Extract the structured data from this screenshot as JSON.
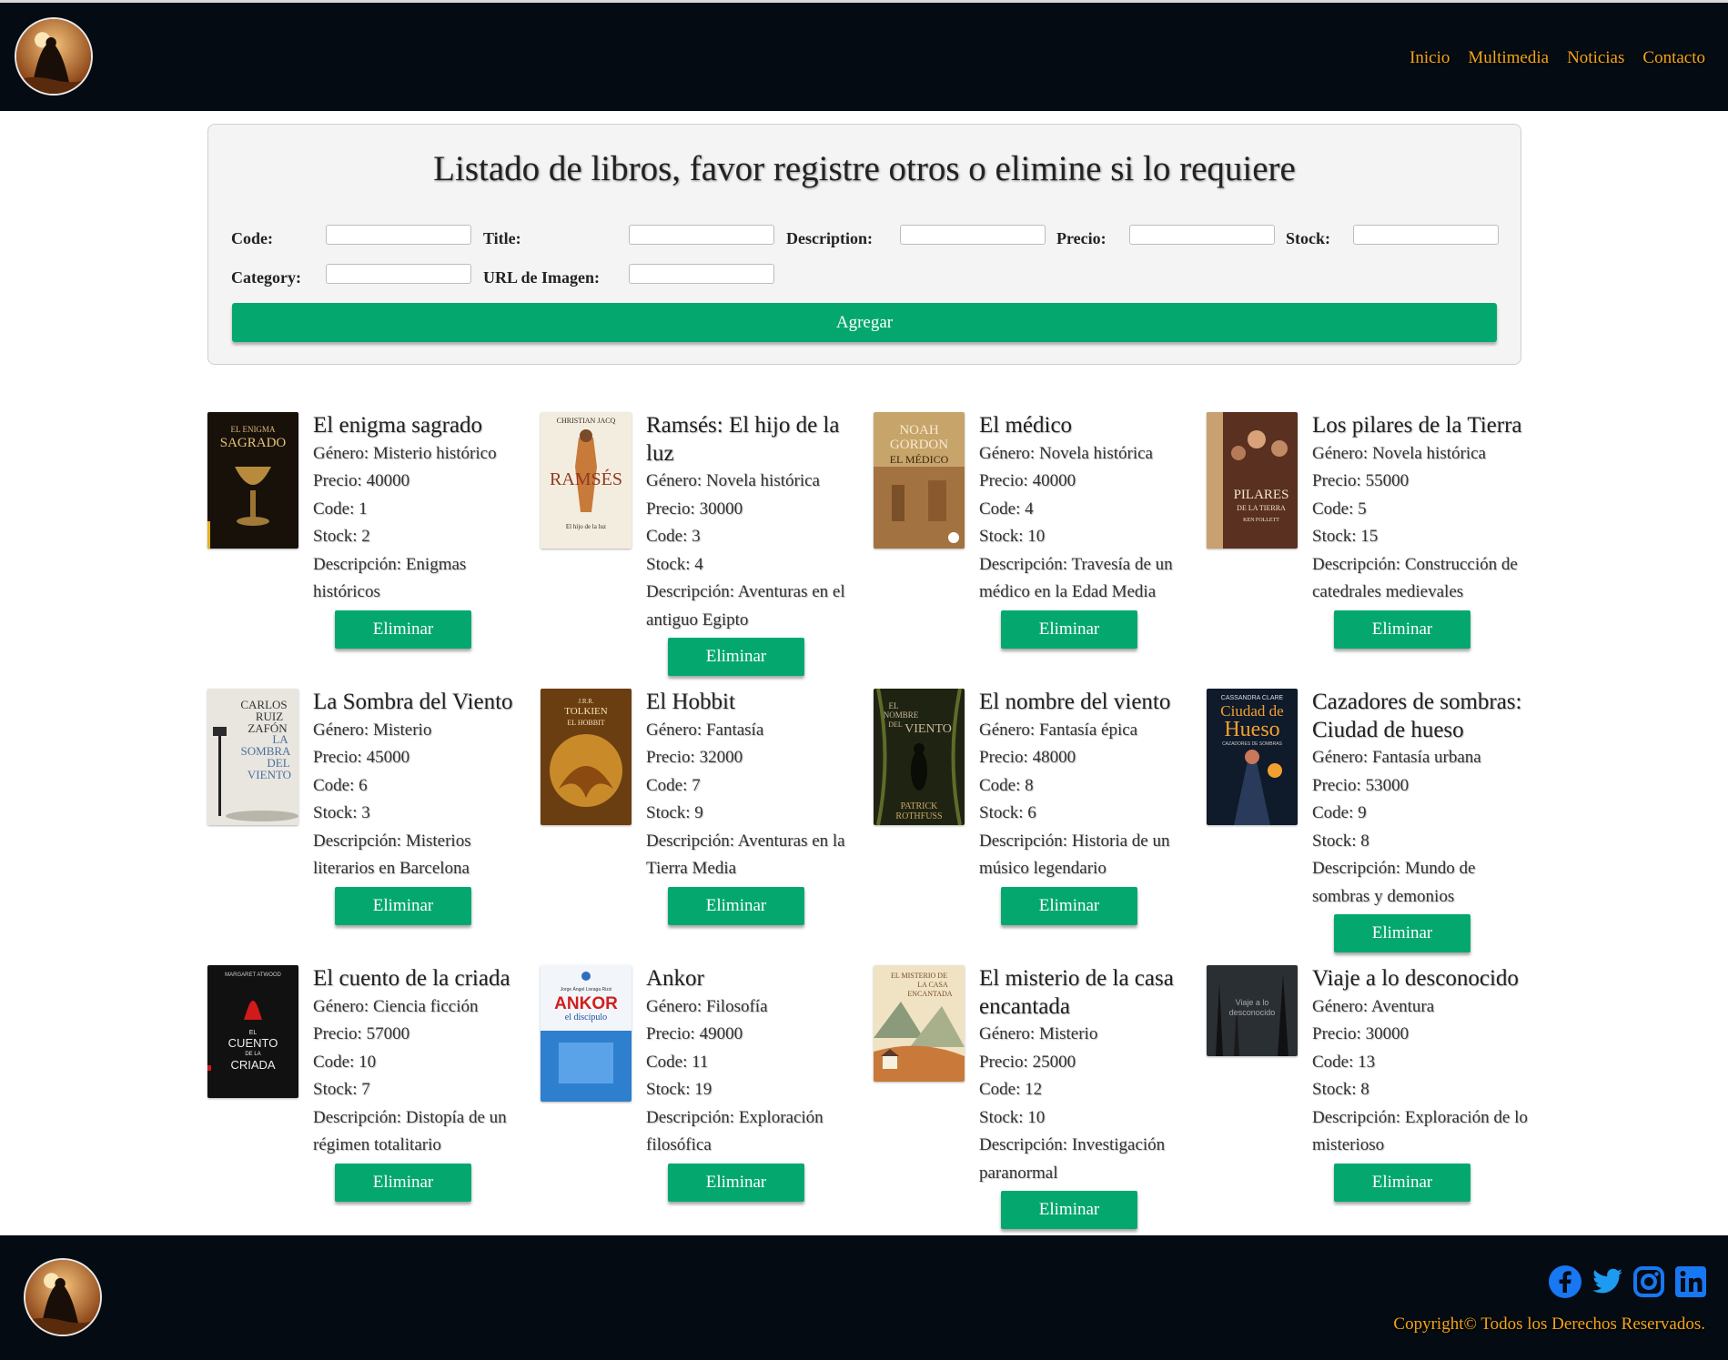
{
  "nav": [
    "Inicio",
    "Multimedia",
    "Noticias",
    "Contacto"
  ],
  "form": {
    "heading": "Listado de libros, favor registre otros o elimine si lo requiere",
    "labels": {
      "code": "Code:",
      "title": "Title:",
      "description": "Description:",
      "precio": "Precio:",
      "stock": "Stock:",
      "category": "Category:",
      "image_url": "URL de Imagen:"
    },
    "values": {
      "code": "",
      "title": "",
      "description": "",
      "precio": "",
      "stock": "",
      "category": "",
      "image_url": ""
    },
    "submit_label": "Agregar"
  },
  "books": [
    {
      "title": "El enigma sagrado",
      "genre": "Género: Misterio histórico",
      "price": "Precio: 40000",
      "code": "Code: 1",
      "stock": "Stock: 2",
      "description": "Descripción: Enigmas históricos",
      "delete_label": "Eliminar",
      "cover_text": [
        "EL ENIGMA",
        "SAGRADO"
      ]
    },
    {
      "title": "Ramsés: El hijo de la luz",
      "genre": "Género: Novela histórica",
      "price": "Precio: 30000",
      "code": "Code: 3",
      "stock": "Stock: 4",
      "description": "Descripción: Aventuras en el antiguo Egipto",
      "delete_label": "Eliminar",
      "cover_text": [
        "CHRISTIAN JACQ",
        "RAMSÉS",
        "El hijo de la luz"
      ]
    },
    {
      "title": "El médico",
      "genre": "Género: Novela histórica",
      "price": "Precio: 40000",
      "code": "Code: 4",
      "stock": "Stock: 10",
      "description": "Descripción: Travesía de un médico en la Edad Media",
      "delete_label": "Eliminar",
      "cover_text": [
        "NOAH",
        "GORDON",
        "EL MÉDICO"
      ]
    },
    {
      "title": "Los pilares de la Tierra",
      "genre": "Género: Novela histórica",
      "price": "Precio: 55000",
      "code": "Code: 5",
      "stock": "Stock: 15",
      "description": "Descripción: Construcción de catedrales medievales",
      "delete_label": "Eliminar",
      "cover_text": [
        "PILARES",
        "DE LA TIERRA",
        "KEN FOLLETT"
      ]
    },
    {
      "title": "La Sombra del Viento",
      "genre": "Género: Misterio",
      "price": "Precio: 45000",
      "code": "Code: 6",
      "stock": "Stock: 3",
      "description": "Descripción: Misterios literarios en Barcelona",
      "delete_label": "Eliminar",
      "cover_text": [
        "CARLOS",
        "RUIZ",
        "ZAFÓN",
        "LA",
        "SOMBRA",
        "DEL",
        "VIENTO"
      ]
    },
    {
      "title": "El Hobbit",
      "genre": "Género: Fantasía",
      "price": "Precio: 32000",
      "code": "Code: 7",
      "stock": "Stock: 9",
      "description": "Descripción: Aventuras en la Tierra Media",
      "delete_label": "Eliminar",
      "cover_text": [
        "J.R.R.",
        "TOLKIEN",
        "EL HOBBIT"
      ]
    },
    {
      "title": "El nombre del viento",
      "genre": "Género: Fantasía épica",
      "price": "Precio: 48000",
      "code": "Code: 8",
      "stock": "Stock: 6",
      "description": "Descripción: Historia de un músico legendario",
      "delete_label": "Eliminar",
      "cover_text": [
        "EL",
        "NOMBRE",
        "DEL",
        "VIENTO",
        "PATRICK",
        "ROTHFUSS"
      ]
    },
    {
      "title": "Cazadores de sombras: Ciudad de hueso",
      "genre": "Género: Fantasía urbana",
      "price": "Precio: 53000",
      "code": "Code: 9",
      "stock": "Stock: 8",
      "description": "Descripción: Mundo de sombras y demonios",
      "delete_label": "Eliminar",
      "cover_text": [
        "CASSANDRA CLARE",
        "Ciudad de",
        "Hueso",
        "CAZADORES DE SOMBRAS"
      ]
    },
    {
      "title": "El cuento de la criada",
      "genre": "Género: Ciencia ficción",
      "price": "Precio: 57000",
      "code": "Code: 10",
      "stock": "Stock: 7",
      "description": "Descripción: Distopía de un régimen totalitario",
      "delete_label": "Eliminar",
      "cover_text": [
        "MARGARET ATWOOD",
        "EL",
        "CUENTO",
        "DE LA",
        "CRIADA"
      ]
    },
    {
      "title": "Ankor",
      "genre": "Género: Filosofía",
      "price": "Precio: 49000",
      "code": "Code: 11",
      "stock": "Stock: 19",
      "description": "Descripción: Exploración filosófica",
      "delete_label": "Eliminar",
      "cover_text": [
        "Jorge Ángel Livraga Rizzi",
        "ANKOR",
        "el discípulo"
      ]
    },
    {
      "title": "El misterio de la casa encantada",
      "genre": "Género: Misterio",
      "price": "Precio: 25000",
      "code": "Code: 12",
      "stock": "Stock: 10",
      "description": "Descripción: Investigación paranormal",
      "delete_label": "Eliminar",
      "cover_text": [
        "EL MISTERIO DE",
        "LA CASA",
        "ENCANTADA"
      ]
    },
    {
      "title": "Viaje a lo desconocido",
      "genre": "Género: Aventura",
      "price": "Precio: 30000",
      "code": "Code: 13",
      "stock": "Stock: 8",
      "description": "Descripción: Exploración de lo misterioso",
      "delete_label": "Eliminar",
      "cover_text": [
        "Viaje a lo",
        "desconocido"
      ]
    }
  ],
  "footer": {
    "copyright": "Copyright© Todos los Derechos Reservados.",
    "social": [
      "facebook",
      "twitter",
      "instagram",
      "linkedin"
    ]
  },
  "colors": {
    "header_bg": "#040b12",
    "accent": "#f3a417",
    "button": "#04a86f",
    "panel_bg": "#f4f4f4"
  }
}
